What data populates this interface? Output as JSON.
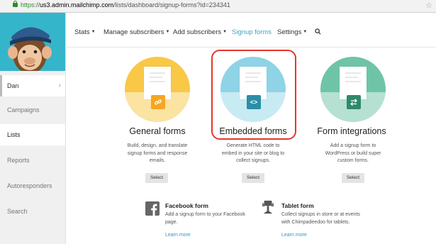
{
  "browser": {
    "url_scheme": "https",
    "url_sep": "://",
    "url_host": "us3.admin.mailchimp.com",
    "url_path": "/lists/dashboard/signup-forms?id=234341"
  },
  "sidebar": {
    "user": "Dan",
    "items": [
      {
        "label": "Campaigns"
      },
      {
        "label": "Lists"
      },
      {
        "label": "Reports"
      },
      {
        "label": "Autoresponders"
      },
      {
        "label": "Search"
      }
    ]
  },
  "nav": {
    "items": [
      "Stats",
      "Manage subscribers",
      "Add subscribers",
      "Signup forms",
      "Settings"
    ],
    "current": "Signup forms"
  },
  "cards": [
    {
      "title": "General forms",
      "desc": [
        "Build, design, and translate",
        "signup forms and response",
        "emails."
      ],
      "button": "Select",
      "color_top": "#f9c847",
      "color_bottom": "#fbe3a2",
      "badge_color": "#f5a623",
      "icon": "link-icon"
    },
    {
      "title": "Embedded forms",
      "desc": [
        "Generate HTML code to",
        "embed in your site or blog to",
        "collect signups."
      ],
      "button": "Select",
      "color_top": "#8fd3e6",
      "color_bottom": "#c8eaf3",
      "badge_color": "#2a8fa6",
      "icon": "code-icon"
    },
    {
      "title": "Form integrations",
      "desc": [
        "Add a signup form to",
        "WordPress or build super",
        "custom forms."
      ],
      "button": "Select",
      "color_top": "#6fc4a8",
      "color_bottom": "#b6e1d2",
      "badge_color": "#2e8a6a",
      "icon": "exchange-icon"
    }
  ],
  "bottom": [
    {
      "title": "Facebook form",
      "desc": [
        "Add a signup form to your Facebook",
        "page."
      ],
      "link": "Learn more",
      "icon": "facebook-icon"
    },
    {
      "title": "Tablet form",
      "desc": [
        "Collect signups in store or at events",
        "with Chimpadeedoo for tablets."
      ],
      "link": "Learn more",
      "icon": "tablet-stand-icon"
    }
  ],
  "colors": {
    "accent": "#3aa5c5",
    "highlight": "#e2372a",
    "sidebar_logo_bg": "#35b5c9"
  }
}
